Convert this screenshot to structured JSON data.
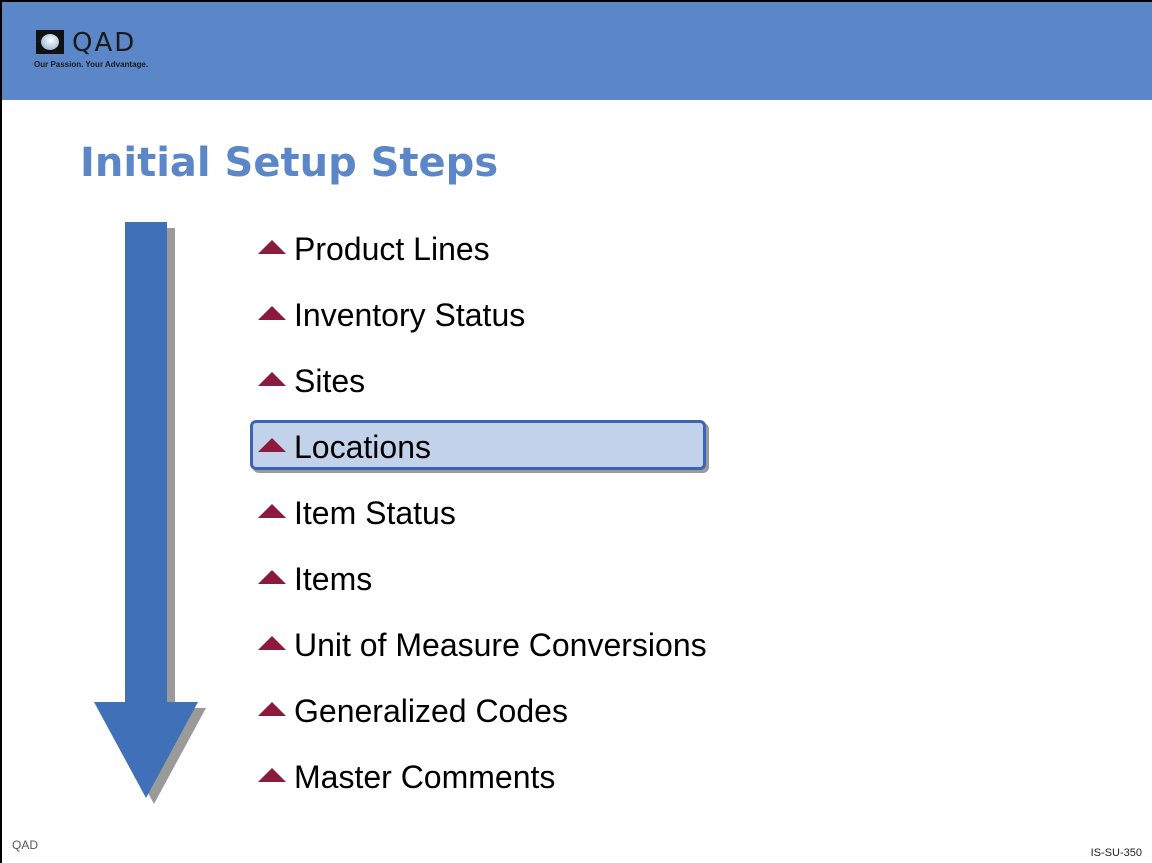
{
  "header": {
    "logo_word": "QAD",
    "logo_tagline": "Our Passion. Your Advantage.",
    "band_color": "#5b87c8"
  },
  "title": "Initial Setup Steps",
  "arrow": {
    "icon": "down-arrow-icon",
    "color": "#4070b8"
  },
  "steps": [
    {
      "label": "Product Lines",
      "highlighted": false
    },
    {
      "label": "Inventory Status",
      "highlighted": false
    },
    {
      "label": "Sites",
      "highlighted": false
    },
    {
      "label": "Locations",
      "highlighted": true
    },
    {
      "label": "Item Status",
      "highlighted": false
    },
    {
      "label": "Items",
      "highlighted": false
    },
    {
      "label": "Unit of Measure Conversions",
      "highlighted": false
    },
    {
      "label": "Generalized Codes",
      "highlighted": false
    },
    {
      "label": "Master Comments",
      "highlighted": false
    }
  ],
  "bullet": {
    "icon": "triangle-bullet-icon",
    "color": "#8b1a3c"
  },
  "footer": {
    "left": "QAD",
    "right": "IS-SU-350"
  }
}
